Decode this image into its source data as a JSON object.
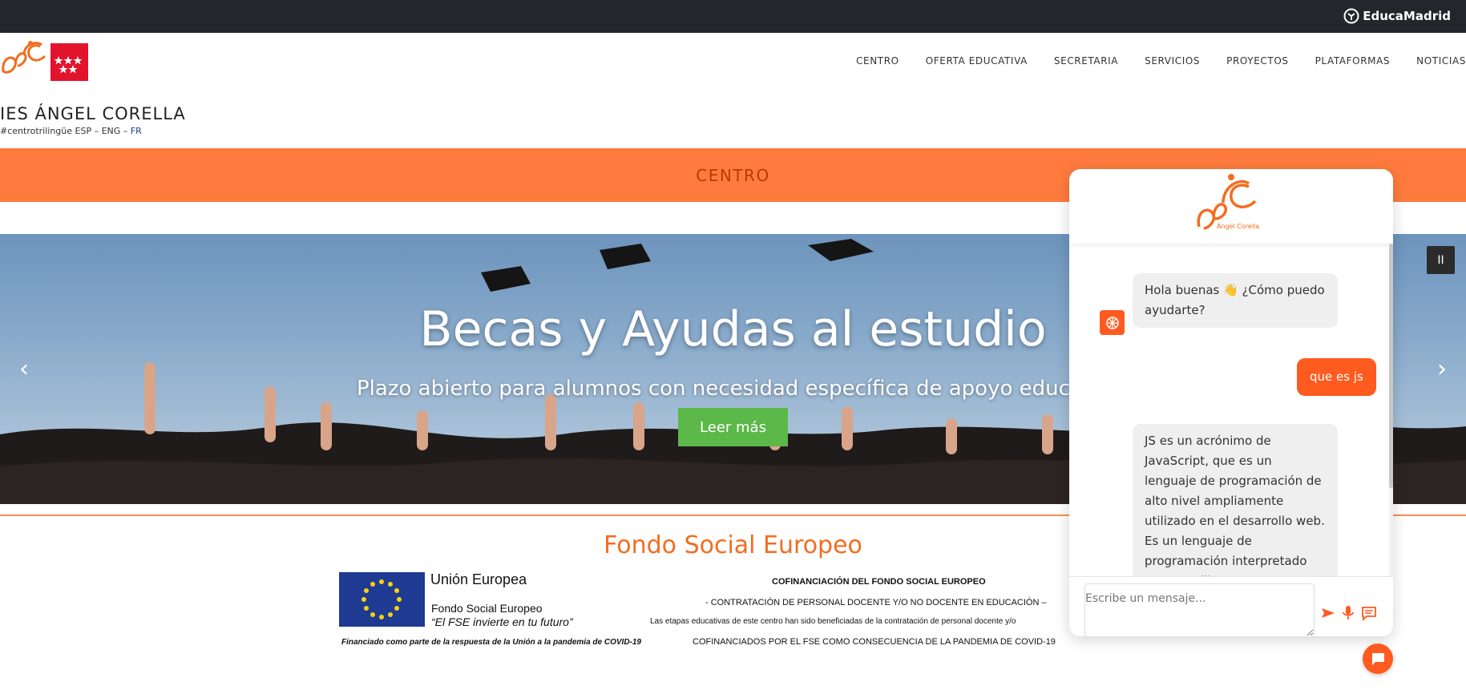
{
  "topbar": {
    "brand": "EducaMadrid",
    "brand_icon": "educamadrid-icon"
  },
  "header": {
    "school_name": "IES ÁNGEL CORELLA",
    "tagline_main": "#centrotrilingüe ESP – ENG – ",
    "tagline_fr": "FR",
    "logo_caption": "Ángel Corella",
    "region_logo": "comunidad-de-madrid-flag"
  },
  "nav": {
    "items": [
      {
        "label": "CENTRO"
      },
      {
        "label": "OFERTA EDUCATIVA"
      },
      {
        "label": "SECRETARIA"
      },
      {
        "label": "SERVICIOS"
      },
      {
        "label": "PROYECTOS"
      },
      {
        "label": "PLATAFORMAS"
      },
      {
        "label": "NOTICIAS"
      }
    ]
  },
  "band": {
    "title": "CENTRO"
  },
  "slider": {
    "title": "Becas y Ayudas al estudio",
    "subtitle": "Plazo abierto para alumnos con necesidad específica de apoyo educa",
    "button_label": "Leer más",
    "prev_glyph": "‹",
    "next_glyph": "›",
    "pause_glyph": "II"
  },
  "fse": {
    "title": "Fondo Social Europeo",
    "eu_title": "Unión Europea",
    "eu_fund": "Fondo Social Europeo",
    "eu_motto": "“El FSE invierte en tu futuro”",
    "eu_note": "Financiado como parte de la respuesta de la Unión a la pandemia de COVID-19",
    "cof_title": "COFINANCIACIÓN DEL FONDO SOCIAL EUROPEO",
    "cof_line2": "- CONTRATACIÓN DE PERSONAL DOCENTE Y/O NO DOCENTE EN EDUCACIÓN –",
    "cof_line3": "Las etapas educativas de este centro han sido beneficiadas de la contratación de personal docente y/o",
    "cof_line4": "COFINANCIADOS POR EL FSE COMO CONSECUENCIA DE LA PANDEMIA DE COVID-19"
  },
  "chat": {
    "logo_caption": "Ángel Corella",
    "messages": [
      {
        "role": "bot",
        "text": "Hola buenas 👋 ¿Cómo puedo ayudarte?"
      },
      {
        "role": "user",
        "text": "que es js"
      },
      {
        "role": "bot",
        "text": "JS es un acrónimo de JavaScript, que es un lenguaje de programación de alto nivel ampliamente utilizado en el desarrollo web. Es un lenguaje de programación interpretado que se utiliza para agregar"
      }
    ],
    "input_placeholder": "Escribe un mensaje..."
  },
  "colors": {
    "accent": "#ff7b3d",
    "chat_accent": "#ff5a1f",
    "button_green": "#5cb848",
    "topbar": "#23272b"
  }
}
